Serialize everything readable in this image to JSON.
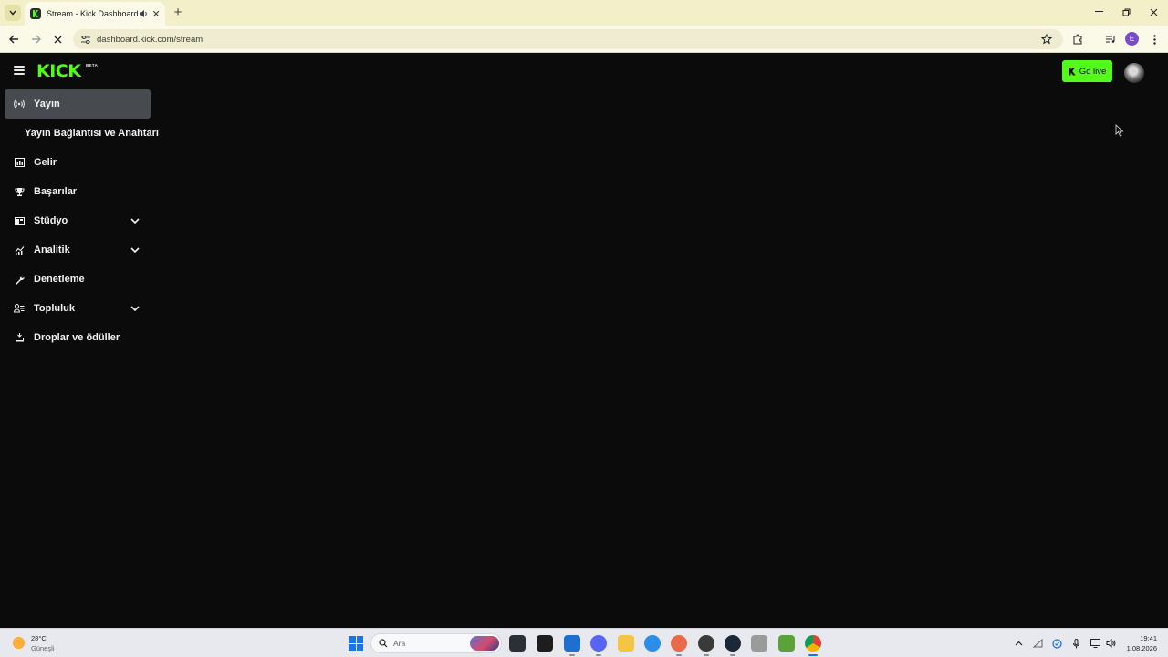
{
  "browser": {
    "tab": {
      "title": "Stream - Kick Dashboard"
    },
    "address": "dashboard.kick.com/stream",
    "profile_initial": "E"
  },
  "header": {
    "logo": "KICK",
    "logo_badge": "BETA",
    "go_live_label": "Go live"
  },
  "sidebar": {
    "items": [
      {
        "label": "Yayın",
        "icon": "broadcast-icon",
        "active": true
      },
      {
        "label": "Yayın Bağlantısı ve Anahtarı",
        "sub": true
      },
      {
        "label": "Gelir",
        "icon": "revenue-chart-icon"
      },
      {
        "label": "Başarılar",
        "icon": "trophy-icon"
      },
      {
        "label": "Stüdyo",
        "icon": "studio-icon",
        "expandable": true
      },
      {
        "label": "Analitik",
        "icon": "analytics-icon",
        "expandable": true
      },
      {
        "label": "Denetleme",
        "icon": "wrench-icon"
      },
      {
        "label": "Topluluk",
        "icon": "community-icon",
        "expandable": true
      },
      {
        "label": "Droplar ve ödüller",
        "icon": "drops-icon"
      }
    ]
  },
  "taskbar": {
    "weather_temp": "28°C",
    "weather_condition": "Güneşli",
    "search_placeholder": "Ara",
    "clock_time": "19:41",
    "clock_date": "1.08.2026"
  },
  "colors": {
    "brand_green": "#53fc18",
    "page_bg": "#0b0b0c",
    "active_nav_bg": "#474a4f"
  }
}
